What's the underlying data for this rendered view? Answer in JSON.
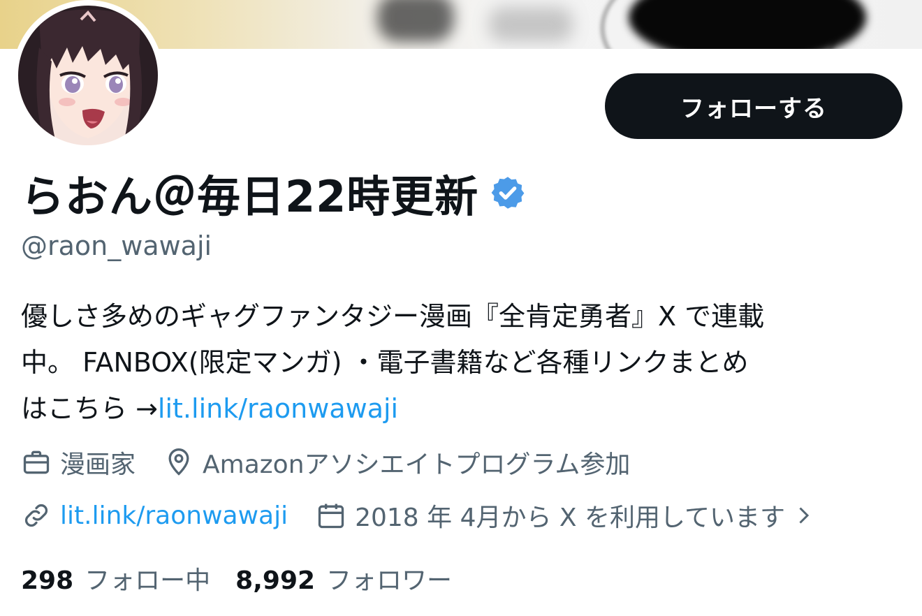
{
  "profile": {
    "display_name": "らおん＠毎日22時更新",
    "handle": "@raon_wawaji",
    "verified_icon": "verified-badge",
    "follow_button_label": "フォローする"
  },
  "bio": {
    "line1": "優しさ多めのギャグファンタジー漫画『全肯定勇者』X で連載",
    "line2": "中。 FANBOX(限定マンガ) ・電子書籍など各種リンクまとめ",
    "line3_prefix": "はこちら →",
    "line3_link": "lit.link/raonwawaji"
  },
  "meta": {
    "profession_icon": "briefcase-icon",
    "profession": "漫画家",
    "location_icon": "location-pin-icon",
    "location": "Amazonアソシエイトプログラム参加",
    "website_icon": "link-icon",
    "website": "lit.link/raonwawaji",
    "joined_icon": "calendar-icon",
    "joined": "2018 年 4月から X を利用しています",
    "chevron_icon": "chevron-right-icon"
  },
  "stats": {
    "following_count": "298",
    "following_label": "フォロー中",
    "followers_count": "8,992",
    "followers_label": "フォロワー"
  },
  "colors": {
    "accent": "#1d9bf0",
    "secondary_text": "#536471",
    "primary_text": "#0f1419",
    "button_bg": "#0f1419",
    "verified": "#4c9be8"
  }
}
